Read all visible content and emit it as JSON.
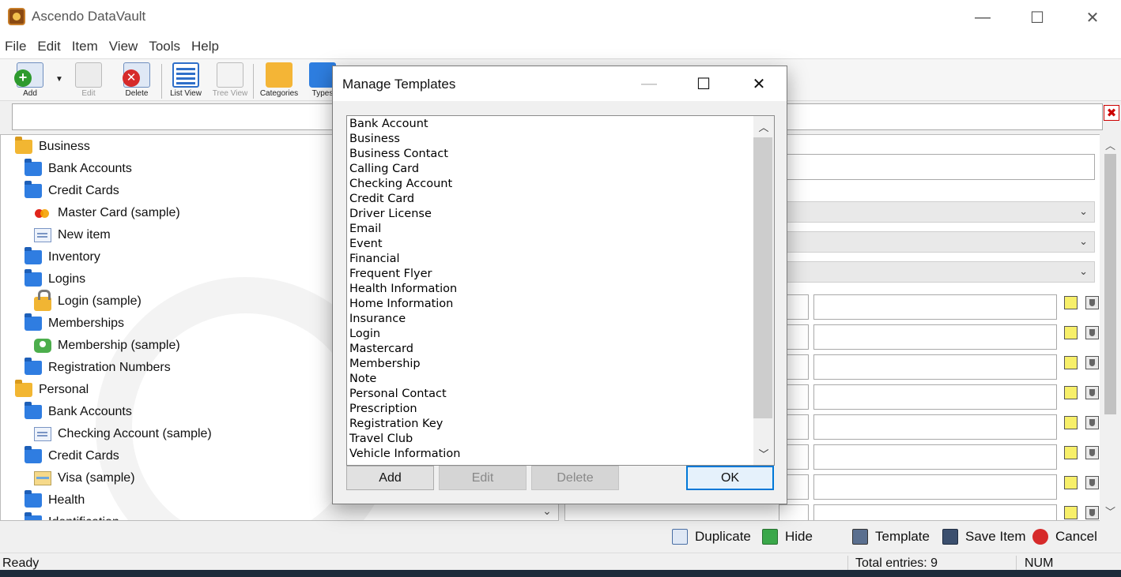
{
  "window": {
    "title": "Ascendo DataVault",
    "minimize": "—",
    "maximize": "☐",
    "close": "✕"
  },
  "menu": [
    "File",
    "Edit",
    "Item",
    "View",
    "Tools",
    "Help"
  ],
  "toolbar": {
    "add": "Add",
    "edit": "Edit",
    "delete": "Delete",
    "list_view": "List View",
    "tree_view": "Tree View",
    "categories": "Categories",
    "types": "Types"
  },
  "search": {
    "value": "",
    "clear": "✖"
  },
  "tree": [
    {
      "label": "Business",
      "kind": "folder-yellow",
      "level": 0
    },
    {
      "label": "Bank Accounts",
      "kind": "folder-blue",
      "level": 1
    },
    {
      "label": "Credit Cards",
      "kind": "folder-blue",
      "level": 1
    },
    {
      "label": "Master Card (sample)",
      "kind": "mastercard",
      "level": 2
    },
    {
      "label": "New item",
      "kind": "note",
      "level": 2
    },
    {
      "label": "Inventory",
      "kind": "folder-blue",
      "level": 1
    },
    {
      "label": "Logins",
      "kind": "folder-blue",
      "level": 1
    },
    {
      "label": "Login (sample)",
      "kind": "lock",
      "level": 2
    },
    {
      "label": "Memberships",
      "kind": "folder-blue",
      "level": 1
    },
    {
      "label": "Membership (sample)",
      "kind": "membership",
      "level": 2
    },
    {
      "label": "Registration Numbers",
      "kind": "folder-blue",
      "level": 1
    },
    {
      "label": "Personal",
      "kind": "folder-yellow",
      "level": 0
    },
    {
      "label": "Bank Accounts",
      "kind": "folder-blue",
      "level": 1
    },
    {
      "label": "Checking Account (sample)",
      "kind": "note",
      "level": 2
    },
    {
      "label": "Credit Cards",
      "kind": "folder-blue",
      "level": 1
    },
    {
      "label": "Visa (sample)",
      "kind": "visa",
      "level": 2
    },
    {
      "label": "Health",
      "kind": "folder-blue",
      "level": 1
    },
    {
      "label": "Identification",
      "kind": "folder-blue",
      "level": 1
    }
  ],
  "actions": {
    "duplicate": "Duplicate",
    "hide": "Hide",
    "template": "Template",
    "save_item": "Save Item",
    "cancel": "Cancel"
  },
  "status": {
    "ready": "Ready",
    "total_entries": "Total entries: 9",
    "num": "NUM"
  },
  "dialog": {
    "title": "Manage Templates",
    "minimize": "—",
    "maximize": "☐",
    "close": "✕",
    "templates": [
      "Bank Account",
      "Business",
      "Business Contact",
      "Calling Card",
      "Checking Account",
      "Credit Card",
      "Driver License",
      "Email",
      "Event",
      "Financial",
      "Frequent Flyer",
      "Health Information",
      "Home Information",
      "Insurance",
      "Login",
      "Mastercard",
      "Membership",
      "Note",
      "Personal Contact",
      "Prescription",
      "Registration Key",
      "Travel Club",
      "Vehicle Information"
    ],
    "buttons": {
      "add": "Add",
      "edit": "Edit",
      "delete": "Delete",
      "ok": "OK"
    }
  }
}
